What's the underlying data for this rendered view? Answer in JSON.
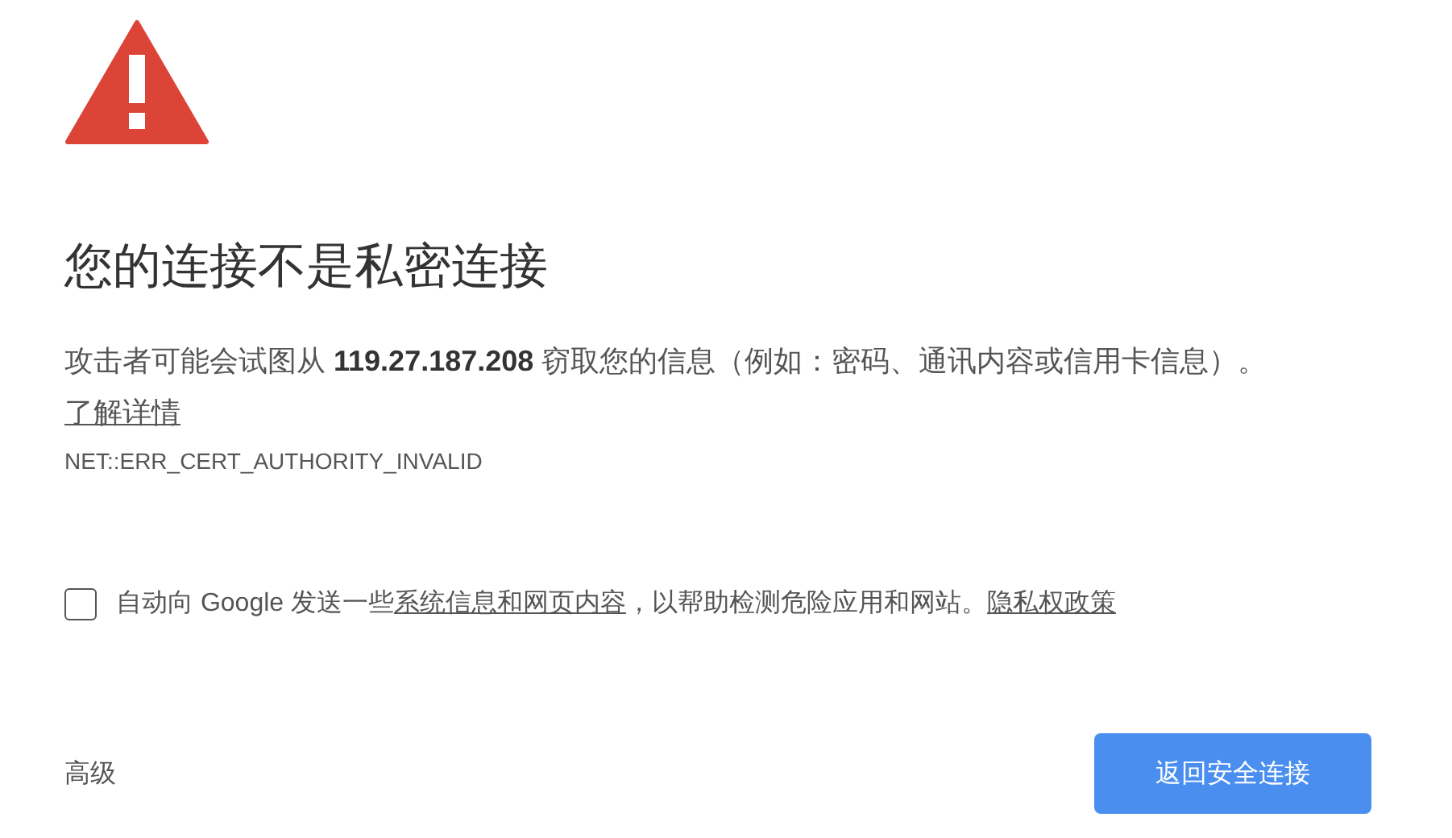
{
  "heading": "您的连接不是私密连接",
  "message": {
    "text": "攻击者可能会试图从 **119.27.187.208** 窃取您的信息（例如：密码、通讯内容或信用卡信息）。",
    "link": "了解详情"
  },
  "error_code": "NET::ERR_CERT_AUTHORITY_INVALID",
  "report_option": {
    "checked": false,
    "parts": [
      {
        "kind": "text",
        "text": "自动向 Google 发送一些"
      },
      {
        "kind": "link",
        "text": "系统信息和网页内容"
      },
      {
        "kind": "text",
        "text": "，以帮助检测危险应用和网站。"
      },
      {
        "kind": "link",
        "text": "隐私权政策"
      }
    ]
  },
  "advanced_link": "高级",
  "back_button": "返回安全连接"
}
